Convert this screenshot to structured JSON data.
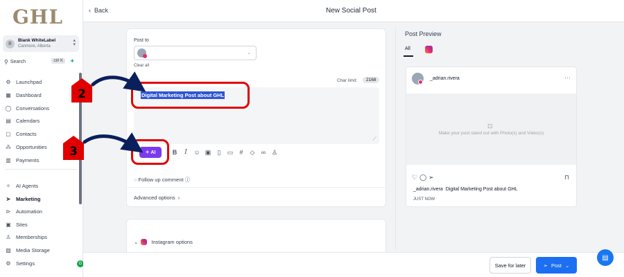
{
  "sidebar": {
    "logo": "GHL",
    "account": {
      "name": "Blank WhiteLabel",
      "location": "Canmore, Alberta",
      "initial": "B"
    },
    "search": {
      "label": "Search",
      "shortcut": "ctrl K"
    },
    "items": [
      {
        "label": "Launchpad",
        "icon": "rocket-icon"
      },
      {
        "label": "Dashboard",
        "icon": "grid-icon"
      },
      {
        "label": "Conversations",
        "icon": "chat-icon"
      },
      {
        "label": "Calendars",
        "icon": "calendar-icon"
      },
      {
        "label": "Contacts",
        "icon": "contacts-icon"
      },
      {
        "label": "Opportunities",
        "icon": "opportunities-icon"
      },
      {
        "label": "Payments",
        "icon": "payments-icon"
      },
      {
        "label": "AI Agents",
        "icon": "sparkle-icon"
      },
      {
        "label": "Marketing",
        "icon": "send-icon",
        "active": true
      },
      {
        "label": "Automation",
        "icon": "automation-icon"
      },
      {
        "label": "Sites",
        "icon": "sites-icon"
      },
      {
        "label": "Memberships",
        "icon": "membership-icon"
      },
      {
        "label": "Media Storage",
        "icon": "image-icon"
      },
      {
        "label": "Settings",
        "icon": "gear-icon"
      }
    ],
    "status_dot": "G"
  },
  "header": {
    "back_label": "Back",
    "title": "New Social Post"
  },
  "composer": {
    "post_to_label": "Post to",
    "clear_all": "Clear all",
    "char_limit_label": "Char limit:",
    "char_count": "2168",
    "content": "Digital Marketing Post about GHL",
    "ai_button": "AI",
    "follow_up": "Follow up comment",
    "advanced": "Advanced options"
  },
  "instagram_options": {
    "label": "Instagram options"
  },
  "preview": {
    "title": "Post Preview",
    "tab_all": "All",
    "username": "_adrian.rivera",
    "media_hint": "Make your post stand out with Photo(s) and Video(s)",
    "caption_user": "_adrian.rivera",
    "caption_text": "Digital Marketing Post about GHL",
    "time": "JUST NOW"
  },
  "footer": {
    "save_later": "Save for later",
    "post": "Post"
  },
  "annotations": {
    "step2": "2",
    "step3": "3"
  },
  "colors": {
    "accent": "#1d6ff2",
    "ai": "#7c3aed",
    "annotation": "#e00000"
  }
}
